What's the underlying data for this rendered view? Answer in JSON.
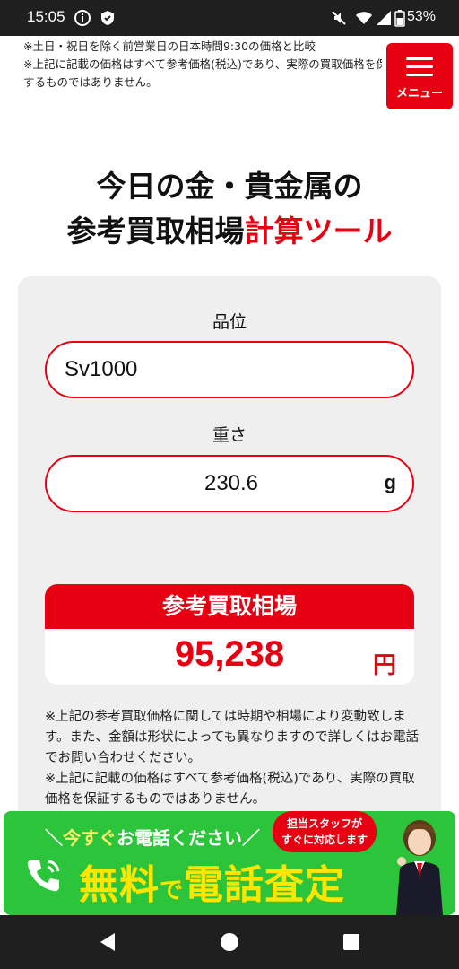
{
  "status_bar": {
    "time": "15:05",
    "battery": "53%"
  },
  "top_notes": [
    "※土日・祝日を除く前営業日の日本時間9:30の価格と比較",
    "※上記に記載の価格はすべて参考価格(税込)であり、実際の買取価格を保証",
    "するものではありません。"
  ],
  "menu": {
    "label": "メニュー"
  },
  "title": {
    "line1": "今日の金・貴金属の",
    "line2_black": "参考買取相場",
    "line2_red": "計算ツール"
  },
  "calculator": {
    "grade_label": "品位",
    "grade_value": "Sv1000",
    "weight_label": "重さ",
    "weight_value": "230.6",
    "weight_unit": "g",
    "result_label": "参考買取相場",
    "result_value": "95,238",
    "result_unit": "円"
  },
  "bottom_notes": [
    "※上記の参考買取価格に関しては時期や相場により変動致します。また、金額は形状によっても異なりますので詳しくはお電話でお問い合わせください。",
    "※上記に記載の価格はすべて参考価格(税込)であり、実際の買取価格を保証するものではありません。"
  ],
  "banner": {
    "top_prefix": "今すぐ",
    "top_suffix": "お電話ください",
    "main_a": "無料",
    "main_b": "で",
    "main_c": "電話査定",
    "bubble_line1": "担当スタッフが",
    "bubble_line2": "すぐに対応します"
  },
  "colors": {
    "accent": "#e60012",
    "banner_green": "#2cc43a",
    "banner_yellow": "#ffe600"
  }
}
